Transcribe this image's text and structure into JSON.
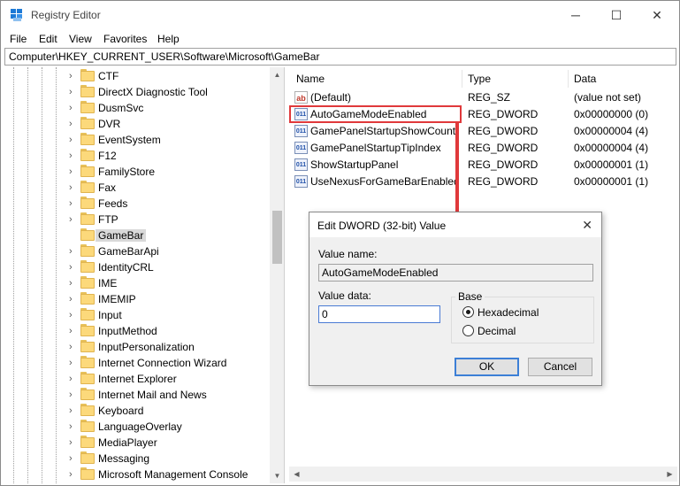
{
  "window": {
    "title": "Registry Editor",
    "controls": {
      "minimize": "─",
      "maximize": "☐",
      "close": "✕"
    }
  },
  "menu": [
    "File",
    "Edit",
    "View",
    "Favorites",
    "Help"
  ],
  "address": "Computer\\HKEY_CURRENT_USER\\Software\\Microsoft\\GameBar",
  "tree": {
    "items": [
      {
        "label": "CTF"
      },
      {
        "label": "DirectX Diagnostic Tool"
      },
      {
        "label": "DusmSvc"
      },
      {
        "label": "DVR"
      },
      {
        "label": "EventSystem"
      },
      {
        "label": "F12"
      },
      {
        "label": "FamilyStore"
      },
      {
        "label": "Fax"
      },
      {
        "label": "Feeds"
      },
      {
        "label": "FTP"
      },
      {
        "label": "GameBar"
      },
      {
        "label": "GameBarApi"
      },
      {
        "label": "IdentityCRL"
      },
      {
        "label": "IME"
      },
      {
        "label": "IMEMIP"
      },
      {
        "label": "Input"
      },
      {
        "label": "InputMethod"
      },
      {
        "label": "InputPersonalization"
      },
      {
        "label": "Internet Connection Wizard"
      },
      {
        "label": "Internet Explorer"
      },
      {
        "label": "Internet Mail and News"
      },
      {
        "label": "Keyboard"
      },
      {
        "label": "LanguageOverlay"
      },
      {
        "label": "MediaPlayer"
      },
      {
        "label": "Messaging"
      },
      {
        "label": "Microsoft Management Console"
      }
    ],
    "selected": "GameBar"
  },
  "values_pane": {
    "headers": {
      "name": "Name",
      "type": "Type",
      "data": "Data"
    },
    "rows": [
      {
        "icon": "ab",
        "name": "(Default)",
        "type": "REG_SZ",
        "data": "(value not set)"
      },
      {
        "icon": "011",
        "name": "AutoGameModeEnabled",
        "type": "REG_DWORD",
        "data": "0x00000000 (0)"
      },
      {
        "icon": "011",
        "name": "GamePanelStartupShowCount",
        "type": "REG_DWORD",
        "data": "0x00000004 (4)"
      },
      {
        "icon": "011",
        "name": "GamePanelStartupTipIndex",
        "type": "REG_DWORD",
        "data": "0x00000004 (4)"
      },
      {
        "icon": "011",
        "name": "ShowStartupPanel",
        "type": "REG_DWORD",
        "data": "0x00000001 (1)"
      },
      {
        "icon": "011",
        "name": "UseNexusForGameBarEnabled",
        "type": "REG_DWORD",
        "data": "0x00000001 (1)"
      }
    ]
  },
  "dialog": {
    "title": "Edit DWORD (32-bit) Value",
    "close": "✕",
    "value_name_label": "Value name:",
    "value_name": "AutoGameModeEnabled",
    "value_data_label": "Value data:",
    "value_data": "0",
    "base_label": "Base",
    "base_options": [
      "Hexadecimal",
      "Decimal"
    ],
    "base_selected": "Hexadecimal",
    "ok": "OK",
    "cancel": "Cancel"
  },
  "colors": {
    "highlight": "#e0393b",
    "folder": "#fcd97b",
    "selected_bg": "#d9d9d9"
  }
}
